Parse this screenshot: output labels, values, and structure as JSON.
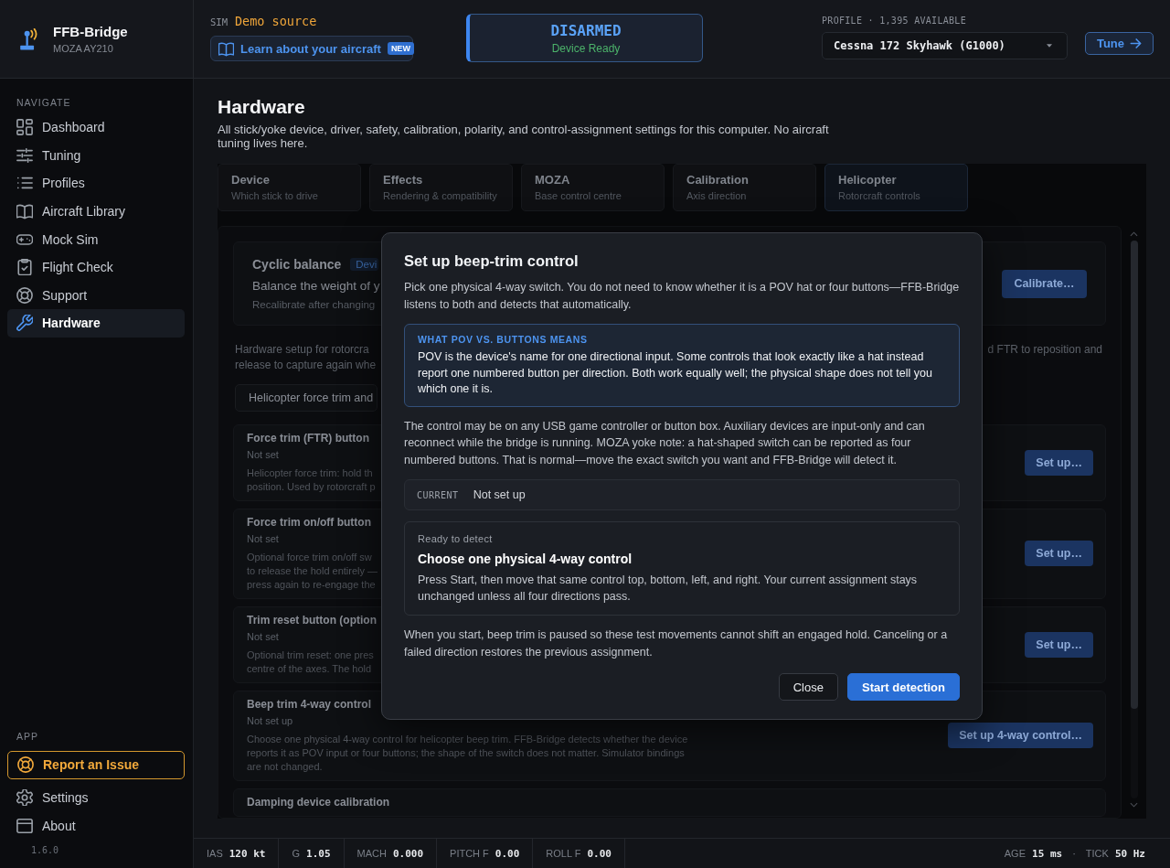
{
  "brand": {
    "name": "FFB-Bridge",
    "device": "MOZA AY210"
  },
  "topbar": {
    "sim": {
      "label": "SIM",
      "value": "Demo source"
    },
    "learn_link": {
      "label": "Learn about your aircraft",
      "badge": "NEW"
    },
    "arm_status": {
      "state": "DISARMED",
      "detail": "Device Ready"
    },
    "profile": {
      "label": "PROFILE · 1,395 AVAILABLE",
      "value": "Cessna 172 Skyhawk (G1000)"
    },
    "tune_button": "Tune"
  },
  "sidebar": {
    "sections": [
      {
        "heading": "NAVIGATE",
        "items": [
          {
            "label": "Dashboard",
            "selected": false
          },
          {
            "label": "Tuning",
            "selected": false
          },
          {
            "label": "Profiles",
            "selected": false
          },
          {
            "label": "Aircraft Library",
            "selected": false
          },
          {
            "label": "Mock Sim",
            "selected": false
          },
          {
            "label": "Flight Check",
            "selected": false
          },
          {
            "label": "Support",
            "selected": false
          },
          {
            "label": "Hardware",
            "selected": true
          }
        ]
      },
      {
        "heading": "APP",
        "items": [
          {
            "label": "Report an Issue",
            "kind": "report",
            "selected": false
          },
          {
            "label": "Settings",
            "kind": "link",
            "selected": false
          },
          {
            "label": "About",
            "kind": "link",
            "selected": false
          }
        ]
      }
    ],
    "version": "1.6.0"
  },
  "page": {
    "title": "Hardware",
    "description": "All stick/yoke device, driver, safety, calibration, polarity, and control-assignment settings for this computer. No aircraft tuning lives here.",
    "tabs": [
      {
        "title": "Device",
        "subtitle": "Which stick to drive",
        "selected": false
      },
      {
        "title": "Effects",
        "subtitle": "Rendering & compatibility",
        "selected": false
      },
      {
        "title": "MOZA",
        "subtitle": "Base control centre",
        "selected": false
      },
      {
        "title": "Calibration",
        "subtitle": "Axis direction",
        "selected": false
      },
      {
        "title": "Helicopter",
        "subtitle": "Rotorcraft controls",
        "selected": true
      }
    ]
  },
  "panel": {
    "balance_card": {
      "title": "Cyclic balance",
      "tag": "Devi",
      "heading": "Balance the weight of y",
      "note": "Recalibrate after changing",
      "button": "Calibrate…"
    },
    "intro": {
      "left_lines": [
        "Hardware setup for rotorcra",
        "release to capture again whe"
      ],
      "right_line": "d FTR to reposition and"
    },
    "section_toggle": "Helicopter force trim and",
    "rows": [
      {
        "title": "Force trim (FTR) button",
        "status": "Not set",
        "description_lines": [
          "Helicopter force trim: hold th",
          "position. Used by rotorcraft p"
        ],
        "button": "Set up…"
      },
      {
        "title": "Force trim on/off button",
        "status": "Not set",
        "description_lines": [
          "Optional force trim on/off sw",
          "to release the hold entirely —",
          "press again to re-engage the"
        ],
        "button": "Set up…"
      },
      {
        "title": "Trim reset button (option",
        "status": "Not set",
        "description_lines": [
          "Optional trim reset: one pres",
          "centre of the axes. The hold"
        ],
        "button": "Set up…"
      },
      {
        "title": "Beep trim 4-way control",
        "status": "Not set up",
        "description_lines": [
          "Choose one physical 4-way control for helicopter beep trim. FFB-Bridge detects whether the device",
          "reports it as POV input or four buttons; the shape of the switch does not matter. Simulator bindings",
          "are not changed."
        ],
        "button": "Set up 4-way control…"
      },
      {
        "title": "Damping device calibration"
      }
    ]
  },
  "dialog": {
    "title": "Set up beep-trim control",
    "intro": "Pick one physical 4-way switch. You do not need to know whether it is a POV hat or four buttons—FFB-Bridge listens to both and detects that automatically.",
    "info": {
      "heading": "WHAT POV VS. BUTTONS MEANS",
      "text": "POV is the device's name for one directional input. Some controls that look exactly like a hat instead report one numbered button per direction. Both work equally well; the physical shape does not tell you which one it is."
    },
    "note": "The control may be on any USB game controller or button box. Auxiliary devices are input-only and can reconnect while the bridge is running. MOZA yoke note: a hat-shaped switch can be reported as four numbered buttons. That is normal—move the exact switch you want and FFB-Bridge will detect it.",
    "current": {
      "label": "CURRENT",
      "value": "Not set up"
    },
    "detect": {
      "status": "Ready to detect",
      "title": "Choose one physical 4-way control",
      "text": "Press Start, then move that same control top, bottom, left, and right. Your current assignment stays unchanged unless all four directions pass."
    },
    "footer": "When you start, beep trim is paused so these test movements cannot shift an engaged hold. Canceling or a failed direction restores the previous assignment.",
    "buttons": [
      {
        "label": "Close",
        "kind": "secondary"
      },
      {
        "label": "Start detection",
        "kind": "primary"
      }
    ]
  },
  "status_bar": {
    "readouts": [
      {
        "label": "IAS",
        "value": "120 kt"
      },
      {
        "label": "G",
        "value": "1.05"
      },
      {
        "label": "MACH",
        "value": "0.000"
      },
      {
        "label": "PITCH F",
        "value": "0.00"
      },
      {
        "label": "ROLL F",
        "value": "0.00"
      }
    ],
    "timing": [
      {
        "label": "AGE",
        "value": "15 ms"
      },
      {
        "label": "TICK",
        "value": "50 Hz"
      }
    ],
    "separator": "·"
  }
}
